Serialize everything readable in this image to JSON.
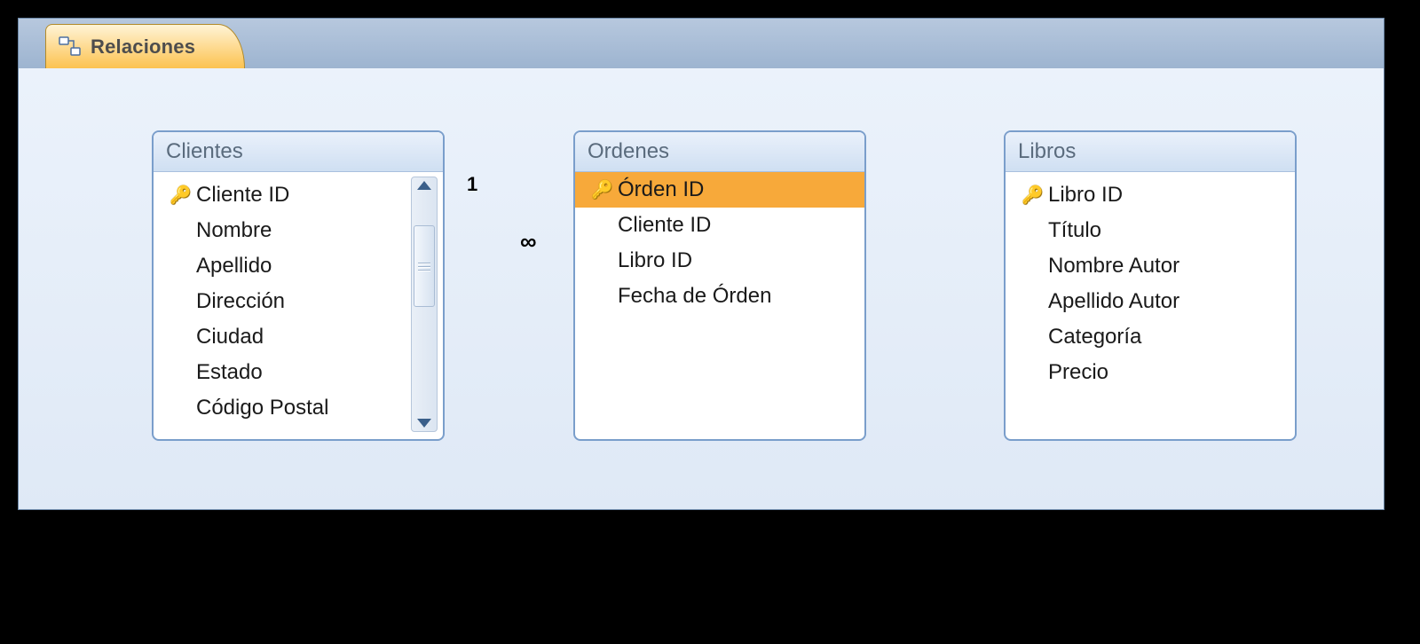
{
  "tab": {
    "label": "Relaciones"
  },
  "tables": {
    "clientes": {
      "title": "Clientes",
      "fields": [
        "Cliente ID",
        "Nombre",
        "Apellido",
        "Dirección",
        "Ciudad",
        "Estado",
        "Código Postal"
      ],
      "primary_key_index": 0
    },
    "ordenes": {
      "title": "Ordenes",
      "fields": [
        "Órden ID",
        "Cliente ID",
        "Libro ID",
        "Fecha de Órden"
      ],
      "primary_key_index": 0,
      "selected_index": 0
    },
    "libros": {
      "title": "Libros",
      "fields": [
        "Libro ID",
        "Título",
        "Nombre Autor",
        "Apellido Autor",
        "Categoría",
        "Precio"
      ],
      "primary_key_index": 0
    }
  },
  "relationships": {
    "left_one": "1",
    "left_many": "∞"
  }
}
